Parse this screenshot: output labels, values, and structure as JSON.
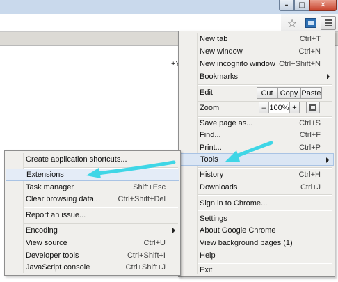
{
  "window": {
    "minimize_icon": "minimize-icon",
    "maximize_icon": "maximize-icon",
    "close_icon": "close-icon",
    "min_glyph": "–",
    "max_glyph": "□",
    "close_glyph": "✕"
  },
  "toolbar": {
    "star_glyph": "☆"
  },
  "page": {
    "text": "+Y"
  },
  "main_menu": {
    "new_tab": {
      "label": "New tab",
      "shortcut": "Ctrl+T"
    },
    "new_window": {
      "label": "New window",
      "shortcut": "Ctrl+N"
    },
    "new_incognito": {
      "label": "New incognito window",
      "shortcut": "Ctrl+Shift+N"
    },
    "bookmarks": {
      "label": "Bookmarks"
    },
    "edit": {
      "label": "Edit",
      "cut": "Cut",
      "copy": "Copy",
      "paste": "Paste"
    },
    "zoom": {
      "label": "Zoom",
      "minus": "–",
      "value": "100%",
      "plus": "+"
    },
    "save_page": {
      "label": "Save page as...",
      "shortcut": "Ctrl+S"
    },
    "find": {
      "label": "Find...",
      "shortcut": "Ctrl+F"
    },
    "print": {
      "label": "Print...",
      "shortcut": "Ctrl+P"
    },
    "tools": {
      "label": "Tools"
    },
    "history": {
      "label": "History",
      "shortcut": "Ctrl+H"
    },
    "downloads": {
      "label": "Downloads",
      "shortcut": "Ctrl+J"
    },
    "sign_in": {
      "label": "Sign in to Chrome..."
    },
    "settings": {
      "label": "Settings"
    },
    "about": {
      "label": "About Google Chrome"
    },
    "background_pages": {
      "label": "View background pages (1)"
    },
    "help": {
      "label": "Help"
    },
    "exit": {
      "label": "Exit"
    }
  },
  "tools_menu": {
    "create_shortcuts": {
      "label": "Create application shortcuts..."
    },
    "extensions": {
      "label": "Extensions"
    },
    "task_manager": {
      "label": "Task manager",
      "shortcut": "Shift+Esc"
    },
    "clear_browsing": {
      "label": "Clear browsing data...",
      "shortcut": "Ctrl+Shift+Del"
    },
    "report_issue": {
      "label": "Report an issue..."
    },
    "encoding": {
      "label": "Encoding"
    },
    "view_source": {
      "label": "View source",
      "shortcut": "Ctrl+U"
    },
    "developer_tools": {
      "label": "Developer tools",
      "shortcut": "Ctrl+Shift+I"
    },
    "js_console": {
      "label": "JavaScript console",
      "shortcut": "Ctrl+Shift+J"
    }
  },
  "colors": {
    "highlight": "#dbe6f4",
    "annotation_arrow": "#3fd6e6"
  }
}
